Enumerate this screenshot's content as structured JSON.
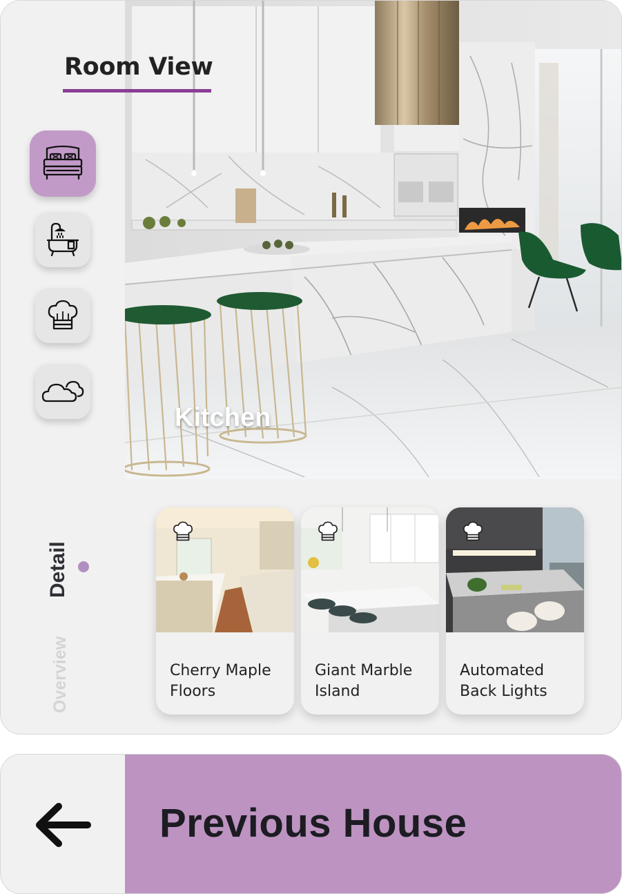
{
  "header": {
    "title": "Room View"
  },
  "rooms": [
    {
      "name": "bedroom",
      "icon": "bed-icon",
      "active": true
    },
    {
      "name": "bathroom",
      "icon": "bathtub-shower-icon",
      "active": false
    },
    {
      "name": "kitchen",
      "icon": "chef-hat-icon",
      "active": false
    },
    {
      "name": "outdoor",
      "icon": "cloud-icon",
      "active": false
    }
  ],
  "hero": {
    "room_label": "Kitchen"
  },
  "tabs": {
    "detail": "Detail",
    "overview": "Overview",
    "active": "detail"
  },
  "features": [
    {
      "title": "Cherry Maple\nFloors",
      "icon": "chef-hat-icon"
    },
    {
      "title": "Giant Marble\nIsland",
      "icon": "chef-hat-icon"
    },
    {
      "title": "Automated\nBack Lights",
      "icon": "chef-hat-icon"
    }
  ],
  "footer": {
    "back_icon": "arrow-left-icon",
    "label": "Previous House"
  },
  "colors": {
    "accent": "#8a3e97",
    "active_button": "#c29ac8",
    "footer_bg": "#bd93c1"
  }
}
